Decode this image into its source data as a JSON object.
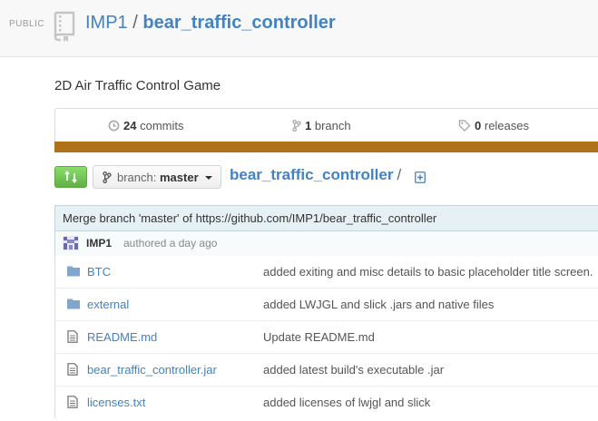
{
  "header": {
    "visibility": "PUBLIC",
    "owner": "IMP1",
    "separator": "/",
    "repo_name": "bear_traffic_controller",
    "icon": "repo-icon"
  },
  "description": "2D Air Traffic Control Game",
  "summary": {
    "commits_count": "24",
    "commits_label": "commits",
    "branches_count": "1",
    "branches_label": "branch",
    "releases_count": "0",
    "releases_label": "releases"
  },
  "language_bar_color": "#b07219",
  "toolbar": {
    "branch_label": "branch:",
    "branch_name": "master",
    "breadcrumb_repo": "bear_traffic_controller",
    "breadcrumb_sep": "/"
  },
  "latest_commit": {
    "message": "Merge branch 'master' of https://github.com/IMP1/bear_traffic_controller",
    "author": "IMP1",
    "time": "authored a day ago"
  },
  "files": [
    {
      "type": "folder",
      "name": "BTC",
      "message": "added exiting and misc details to basic placeholder title screen."
    },
    {
      "type": "folder",
      "name": "external",
      "message": "added LWJGL and slick .jars and native files"
    },
    {
      "type": "file",
      "name": "README.md",
      "message": "Update README.md"
    },
    {
      "type": "file",
      "name": "bear_traffic_controller.jar",
      "message": "added latest build's executable .jar"
    },
    {
      "type": "file",
      "name": "licenses.txt",
      "message": "added licenses of lwjgl and slick"
    }
  ],
  "colors": {
    "link": "#4183c4",
    "compare_button": "#60b044",
    "commit_bg": "#e6f1f6"
  }
}
